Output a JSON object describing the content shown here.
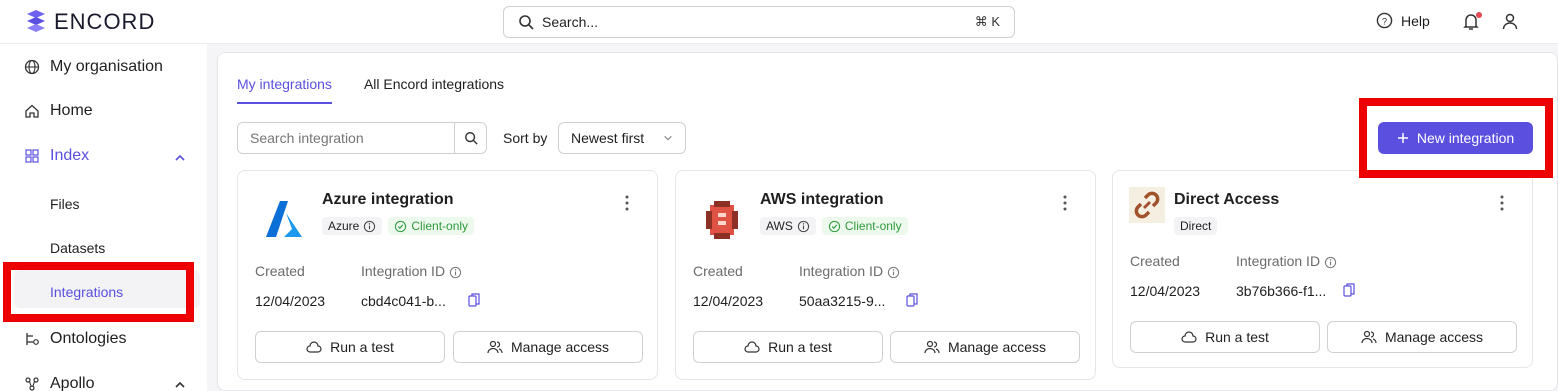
{
  "app": {
    "brand": "ENCORD",
    "accent": "#5b4fe0",
    "highlight": "#ee0000"
  },
  "topbar": {
    "search_label": "Search...",
    "search_shortcut": "⌘ K",
    "help_label": "Help"
  },
  "sidebar": {
    "items": [
      {
        "label": "My organisation",
        "icon": "globe-icon"
      },
      {
        "label": "Home",
        "icon": "home-icon"
      },
      {
        "label": "Index",
        "icon": "grid-icon"
      },
      {
        "label": "Files"
      },
      {
        "label": "Datasets"
      },
      {
        "label": "Integrations"
      },
      {
        "label": "Ontologies",
        "icon": "ontology-icon"
      },
      {
        "label": "Apollo",
        "icon": "apollo-icon"
      }
    ]
  },
  "main": {
    "tabs": [
      {
        "label": "My integrations",
        "active": true
      },
      {
        "label": "All Encord integrations",
        "active": false
      }
    ],
    "search_placeholder": "Search integration",
    "sort_label": "Sort by",
    "sort_value": "Newest first",
    "new_button": "New integration"
  },
  "cards": [
    {
      "title": "Azure integration",
      "provider": "Azure",
      "mode": "Client-only",
      "created_label": "Created",
      "created": "12/04/2023",
      "id_label": "Integration ID",
      "id": "cbd4c041-b...",
      "test_button": "Run a test",
      "access_button": "Manage access"
    },
    {
      "title": "AWS integration",
      "provider": "AWS",
      "mode": "Client-only",
      "created_label": "Created",
      "created": "12/04/2023",
      "id_label": "Integration ID",
      "id": "50aa3215-9...",
      "test_button": "Run a test",
      "access_button": "Manage access"
    },
    {
      "title": "Direct Access",
      "provider": "Direct",
      "created_label": "Created",
      "created": "12/04/2023",
      "id_label": "Integration ID",
      "id": "3b76b366-f1...",
      "test_button": "Run a test",
      "access_button": "Manage access"
    }
  ]
}
